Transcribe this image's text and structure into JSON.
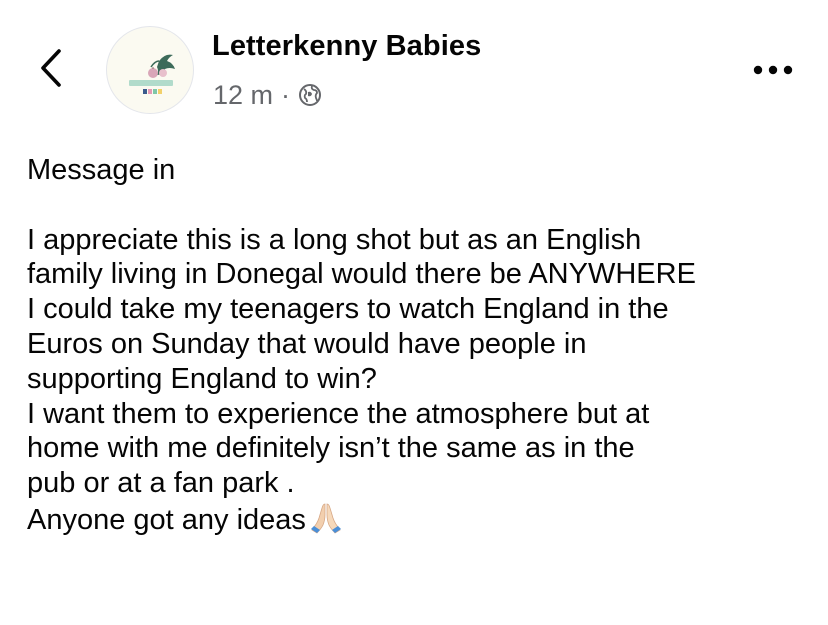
{
  "header": {
    "back_icon": "chevron-left-icon",
    "avatar_icon": "letterkenny-babies-logo",
    "page_name": "Letterkenny Babies",
    "time": "12 m",
    "separator": "·",
    "privacy_icon": "globe-icon",
    "more_icon": "more-options-icon"
  },
  "post": {
    "lines": [
      "Message in",
      "",
      "I appreciate this is a long shot but as an English",
      "family living in Donegal would there be ANYWHERE",
      "I could take my teenagers to watch England  in the",
      "Euros on Sunday that would have people in",
      "supporting England to win?",
      "I want them to experience the atmosphere but at",
      "home with me definitely isn’t the same as in the",
      "pub or at a fan park .",
      "Anyone got any ideas"
    ],
    "trailing_emoji": "folded-hands-icon"
  },
  "colors": {
    "text_primary": "#050505",
    "text_secondary": "#65676b",
    "background": "#ffffff",
    "avatar_bg": "#fbfaf1"
  }
}
